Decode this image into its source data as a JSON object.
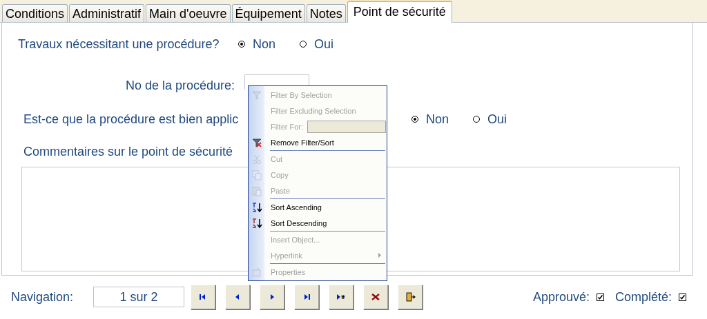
{
  "tabs": [
    {
      "label": "Conditions",
      "selected": false
    },
    {
      "label": "Administratif",
      "selected": false
    },
    {
      "label": "Main d'oeuvre",
      "selected": false
    },
    {
      "label": "Équipement",
      "selected": false
    },
    {
      "label": "Notes",
      "selected": false
    },
    {
      "label": "Point de sécurité",
      "selected": true
    }
  ],
  "form": {
    "question_1": {
      "label": "Travaux nécessitant une procédure?",
      "options": [
        {
          "label": "Non",
          "selected": true
        },
        {
          "label": "Oui",
          "selected": false
        }
      ]
    },
    "procedure_number": {
      "label": "No de la procédure:"
    },
    "question_2": {
      "label": "Est-ce que la procédure est bien applic",
      "options": [
        {
          "label": "Non",
          "selected": true
        },
        {
          "label": "Oui",
          "selected": false
        }
      ]
    },
    "comments": {
      "label": "Commentaires sur le point de sécurité"
    }
  },
  "context_menu": [
    {
      "kind": "item",
      "label": "Filter By Selection",
      "disabled": true
    },
    {
      "kind": "item",
      "label": "Filter Excluding Selection",
      "disabled": true
    },
    {
      "kind": "field",
      "label": "Filter For:",
      "disabled": true
    },
    {
      "kind": "item",
      "label": "Remove Filter/Sort",
      "disabled": false
    },
    {
      "kind": "separator"
    },
    {
      "kind": "item",
      "label": "Cut",
      "disabled": true
    },
    {
      "kind": "item",
      "label": "Copy",
      "disabled": true
    },
    {
      "kind": "item",
      "label": "Paste",
      "disabled": true
    },
    {
      "kind": "separator"
    },
    {
      "kind": "item",
      "label": "Sort Ascending",
      "disabled": false
    },
    {
      "kind": "item",
      "label": "Sort Descending",
      "disabled": false
    },
    {
      "kind": "separator"
    },
    {
      "kind": "item",
      "label": "Insert Object...",
      "disabled": true
    },
    {
      "kind": "item",
      "label": "Hyperlink",
      "disabled": true,
      "submenu": true
    },
    {
      "kind": "separator"
    },
    {
      "kind": "item",
      "label": "Properties",
      "disabled": true
    }
  ],
  "navigation": {
    "label": "Navigation:",
    "record": "1 sur 2"
  },
  "flags": [
    {
      "label": "Approuvé:",
      "checked": true
    },
    {
      "label": "Complété:",
      "checked": true
    }
  ]
}
